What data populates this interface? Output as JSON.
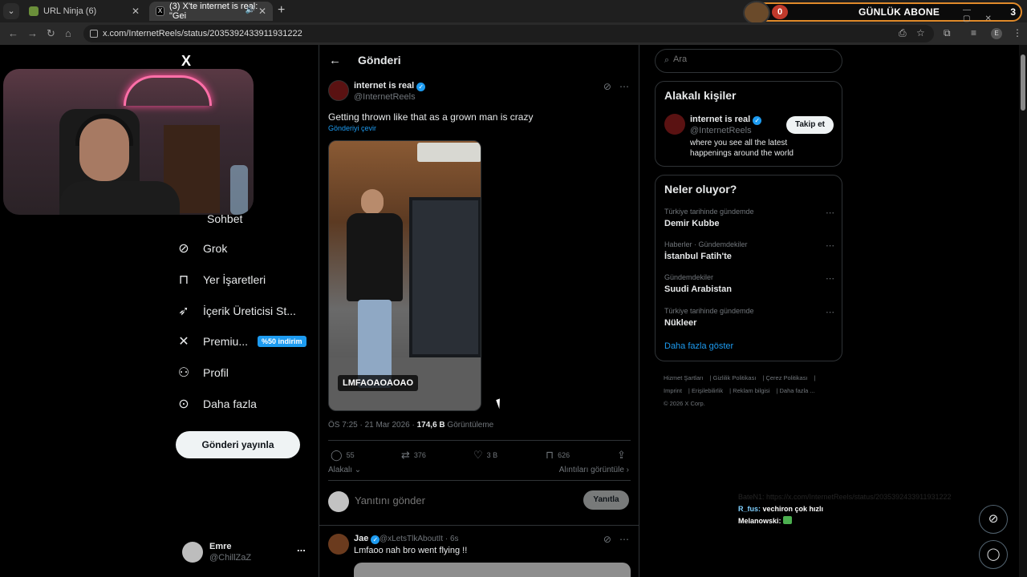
{
  "browser": {
    "tabs": [
      {
        "title": "URL Ninja (6)",
        "active": false
      },
      {
        "title": "(3) X'te internet is real: \"Gei",
        "active": true
      }
    ],
    "new_tab": "+",
    "url": "x.com/InternetReels/status/2035392433911931222",
    "profile_initial": "E"
  },
  "overlay": {
    "sub_count": "0",
    "sub_label": "GÜNLÜK ABONE",
    "sub_total": "3"
  },
  "sidebar": {
    "logo": "X",
    "partial_item": "Sohbet",
    "items": [
      {
        "label": "Grok",
        "icon": "grok-icon"
      },
      {
        "label": "Yer İşaretleri",
        "icon": "bookmark-icon"
      },
      {
        "label": "İçerik Üreticisi St...",
        "icon": "rocket-icon"
      },
      {
        "label": "Premiu...",
        "icon": "x-icon",
        "badge": "%50 indirim"
      },
      {
        "label": "Profil",
        "icon": "person-icon"
      },
      {
        "label": "Daha fazla",
        "icon": "more-circle-icon"
      }
    ],
    "post_button": "Gönderi yayınla",
    "user": {
      "name": "Emre",
      "handle": "@ChillZaZ",
      "more": "..."
    }
  },
  "main": {
    "title": "Gönderi",
    "tweet": {
      "author_name": "internet is real",
      "author_handle": "@InternetReels",
      "text": "Getting thrown like that as a grown man is crazy",
      "translate": "Gönderiyi çevir",
      "media_caption": "LMFAOAOAOAO",
      "time": "ÖS 7:25 · 21 Mar 2026 · ",
      "views": "174,6 B",
      "views_label": " Görüntüleme",
      "stats": {
        "replies": "55",
        "reposts": "376",
        "likes": "3 B",
        "bookmarks": "626"
      },
      "related": "Alakalı",
      "quotes": "Alıntıları görüntüle"
    },
    "reply_box": {
      "placeholder": "Yanıtını gönder",
      "button": "Yanıtla"
    },
    "reply": {
      "name": "Jae",
      "handle": "@xLetsTlkAboutIt · 6s",
      "text": "Lmfaoo nah bro went flying !!"
    }
  },
  "right": {
    "search_placeholder": "Ara",
    "related_people": {
      "title": "Alakalı kişiler",
      "name": "internet is real",
      "handle": "@InternetReels",
      "bio": "where you see all the latest happenings around the world",
      "follow": "Takip et"
    },
    "trends": {
      "title": "Neler oluyor?",
      "items": [
        {
          "context": "Türkiye tarihinde gündemde",
          "name": "Demir Kubbe"
        },
        {
          "context": "Haberler · Gündemdekiler",
          "name": "İstanbul Fatih'te"
        },
        {
          "context": "Gündemdekiler",
          "name": "Suudi Arabistan"
        },
        {
          "context": "Türkiye tarihinde gündemde",
          "name": "Nükleer"
        }
      ],
      "show_more": "Daha fazla göster"
    },
    "footer": [
      "Hizmet Şartları",
      "Gizlilik Politikası",
      "Çerez Politikası",
      "Imprint",
      "Erişilebilirlik",
      "Reklam bilgisi",
      "Daha fazla ...",
      "© 2026 X Corp."
    ]
  },
  "chat": {
    "faint_line": "BateN1: https://x.com/InternetReels/status/2035392433911931222",
    "lines": [
      {
        "user": "R_fus:",
        "message": "vechiron çok hızlı"
      },
      {
        "user": "Melanowski:",
        "message": ""
      }
    ]
  }
}
